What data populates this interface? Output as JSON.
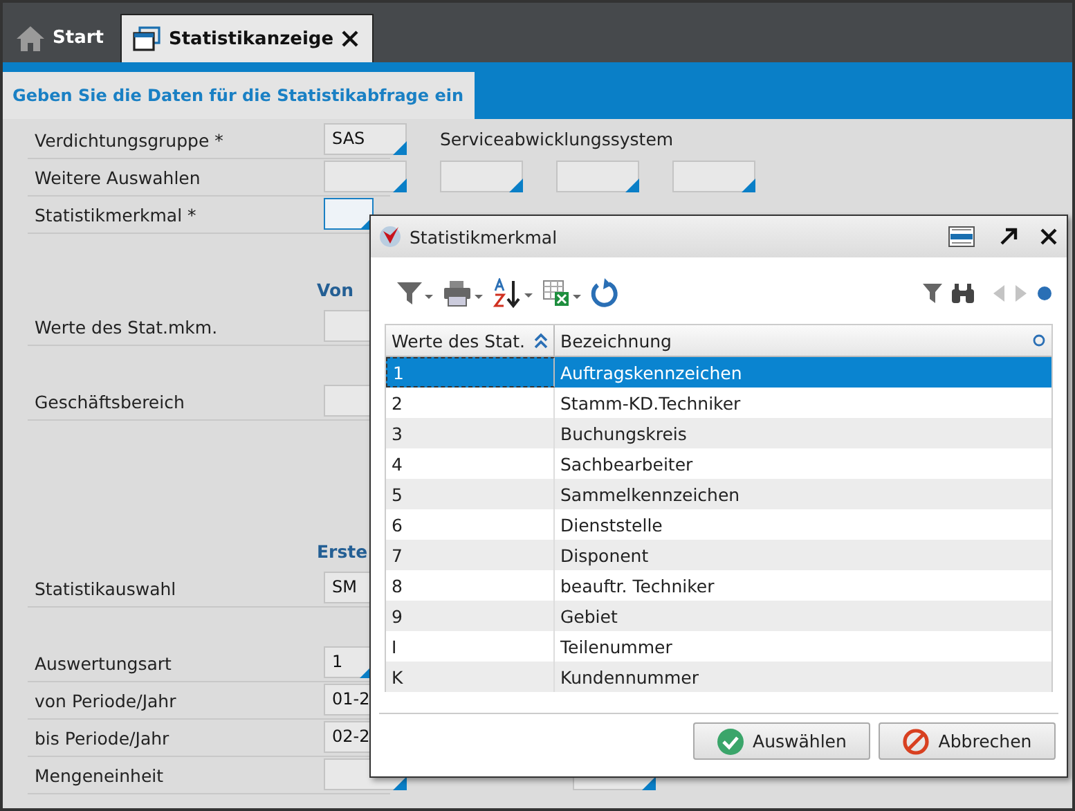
{
  "tabs": [
    {
      "label": "Start",
      "closable": false,
      "selected": false
    },
    {
      "label": "Statistikanzeige",
      "closable": true,
      "selected": true
    }
  ],
  "section_title": "Geben Sie die Daten für die Statistikabfrage ein",
  "form": [
    {
      "kind": "row",
      "label": "Verdichtungsgruppe *",
      "fields": [
        {
          "value": "SAS",
          "lookup": true,
          "focused": false
        }
      ],
      "note": "Serviceabwicklungssystem"
    },
    {
      "kind": "row",
      "label": "Weitere Auswahlen",
      "fields": [
        {
          "lookup": true,
          "focused": false
        },
        {
          "lookup": true,
          "focused": false
        },
        {
          "lookup": true,
          "focused": false
        },
        {
          "lookup": true,
          "focused": false
        }
      ]
    },
    {
      "kind": "row",
      "label": "Statistikmerkmal *",
      "fields": [
        {
          "lookup": true,
          "focused": true
        }
      ]
    },
    {
      "kind": "heading",
      "label": "Von"
    },
    {
      "kind": "row",
      "label": "Werte des Stat.mkm.",
      "fields": [
        {
          "focused": false
        }
      ]
    },
    {
      "kind": "row",
      "label": "Geschäftsbereich",
      "fields": [
        {
          "focused": false
        }
      ]
    },
    {
      "kind": "heading",
      "label": "Erste"
    },
    {
      "kind": "row",
      "label": "Statistikauswahl",
      "fields": [
        {
          "value": "SM",
          "focused": false
        }
      ]
    },
    {
      "kind": "row",
      "label": "Auswertungsart",
      "fields": [
        {
          "value": "1",
          "lookup": true,
          "focused": false
        }
      ]
    },
    {
      "kind": "row",
      "label": "von Periode/Jahr",
      "fields": [
        {
          "value": "01-2",
          "focused": false
        }
      ]
    },
    {
      "kind": "row",
      "label": "bis Periode/Jahr",
      "fields": [
        {
          "value": "02-2",
          "focused": false
        }
      ]
    },
    {
      "kind": "row",
      "label": "Mengeneinheit",
      "fields": [
        {
          "lookup": true,
          "focused": false
        },
        {
          "lookup": true,
          "focused": false
        }
      ]
    }
  ],
  "dialog": {
    "title": "Statistikmerkmal",
    "table": {
      "columns": [
        {
          "label": "Werte des Stat.",
          "sorted": true
        },
        {
          "label": "Bezeichnung",
          "sorted": false
        }
      ],
      "rows": [
        {
          "cells": [
            "1",
            "Auftragskennzeichen"
          ],
          "selected": true
        },
        {
          "cells": [
            "2",
            "Stamm-KD.Techniker"
          ],
          "selected": false
        },
        {
          "cells": [
            "3",
            "Buchungskreis"
          ],
          "selected": false
        },
        {
          "cells": [
            "4",
            "Sachbearbeiter"
          ],
          "selected": false
        },
        {
          "cells": [
            "5",
            "Sammelkennzeichen"
          ],
          "selected": false
        },
        {
          "cells": [
            "6",
            "Dienststelle"
          ],
          "selected": false
        },
        {
          "cells": [
            "7",
            "Disponent"
          ],
          "selected": false
        },
        {
          "cells": [
            "8",
            "beauftr. Techniker"
          ],
          "selected": false
        },
        {
          "cells": [
            "9",
            "Gebiet"
          ],
          "selected": false
        },
        {
          "cells": [
            "I",
            "Teilenummer"
          ],
          "selected": false
        },
        {
          "cells": [
            "K",
            "Kundennummer"
          ],
          "selected": false
        }
      ]
    },
    "buttons": [
      {
        "label": "Auswählen",
        "kind": "ok"
      },
      {
        "label": "Abbrechen",
        "kind": "cancel"
      }
    ]
  }
}
